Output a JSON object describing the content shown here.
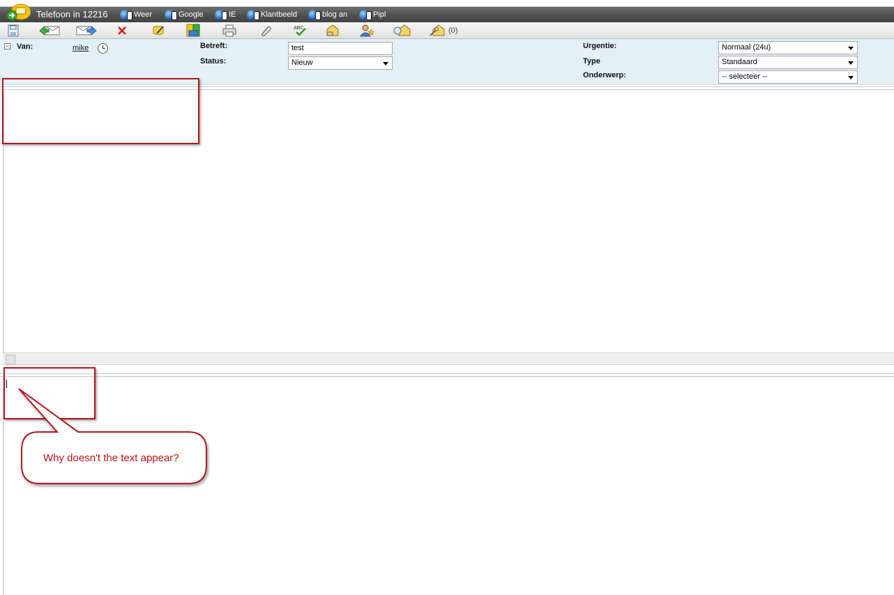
{
  "window": {
    "title": "Telefoon in 12216"
  },
  "quick_links": [
    {
      "label": "Weer",
      "icon": "globe-phone-icon"
    },
    {
      "label": "Google",
      "icon": "globe-phone-icon"
    },
    {
      "label": "IE",
      "icon": "globe-phone-icon"
    },
    {
      "label": "Klantbeeld",
      "icon": "globe-phone-icon"
    },
    {
      "label": "blog an",
      "icon": "globe-phone-icon"
    },
    {
      "label": "Pipl",
      "icon": "globe-phone-icon"
    }
  ],
  "toolbar": {
    "buttons": [
      "save-icon",
      "reply-icon",
      "forward-icon",
      "delete-icon",
      "edit-icon",
      "folder-icon",
      "print-icon",
      "attachment-icon",
      "spellcheck-icon",
      "link-mail-icon",
      "assign-user-icon",
      "move-mail-icon",
      "key-mail-icon"
    ],
    "count_label": "(0)"
  },
  "header": {
    "van_label": "Van:",
    "van_value": "mike",
    "betreft_label": "Betreft:",
    "betreft_value": "test",
    "status_label": "Status:",
    "status_value": "Nieuw",
    "urgentie_label": "Urgentie:",
    "urgentie_value": "Normaal (24u)",
    "type_label": "Type",
    "type_value": "Standaard",
    "onderwerp_label": "Onderwerp:",
    "onderwerp_value": "-- selecteer --"
  },
  "annotation": {
    "callout_text": "Why doesn't the text appear?",
    "color": "#b8121a"
  }
}
